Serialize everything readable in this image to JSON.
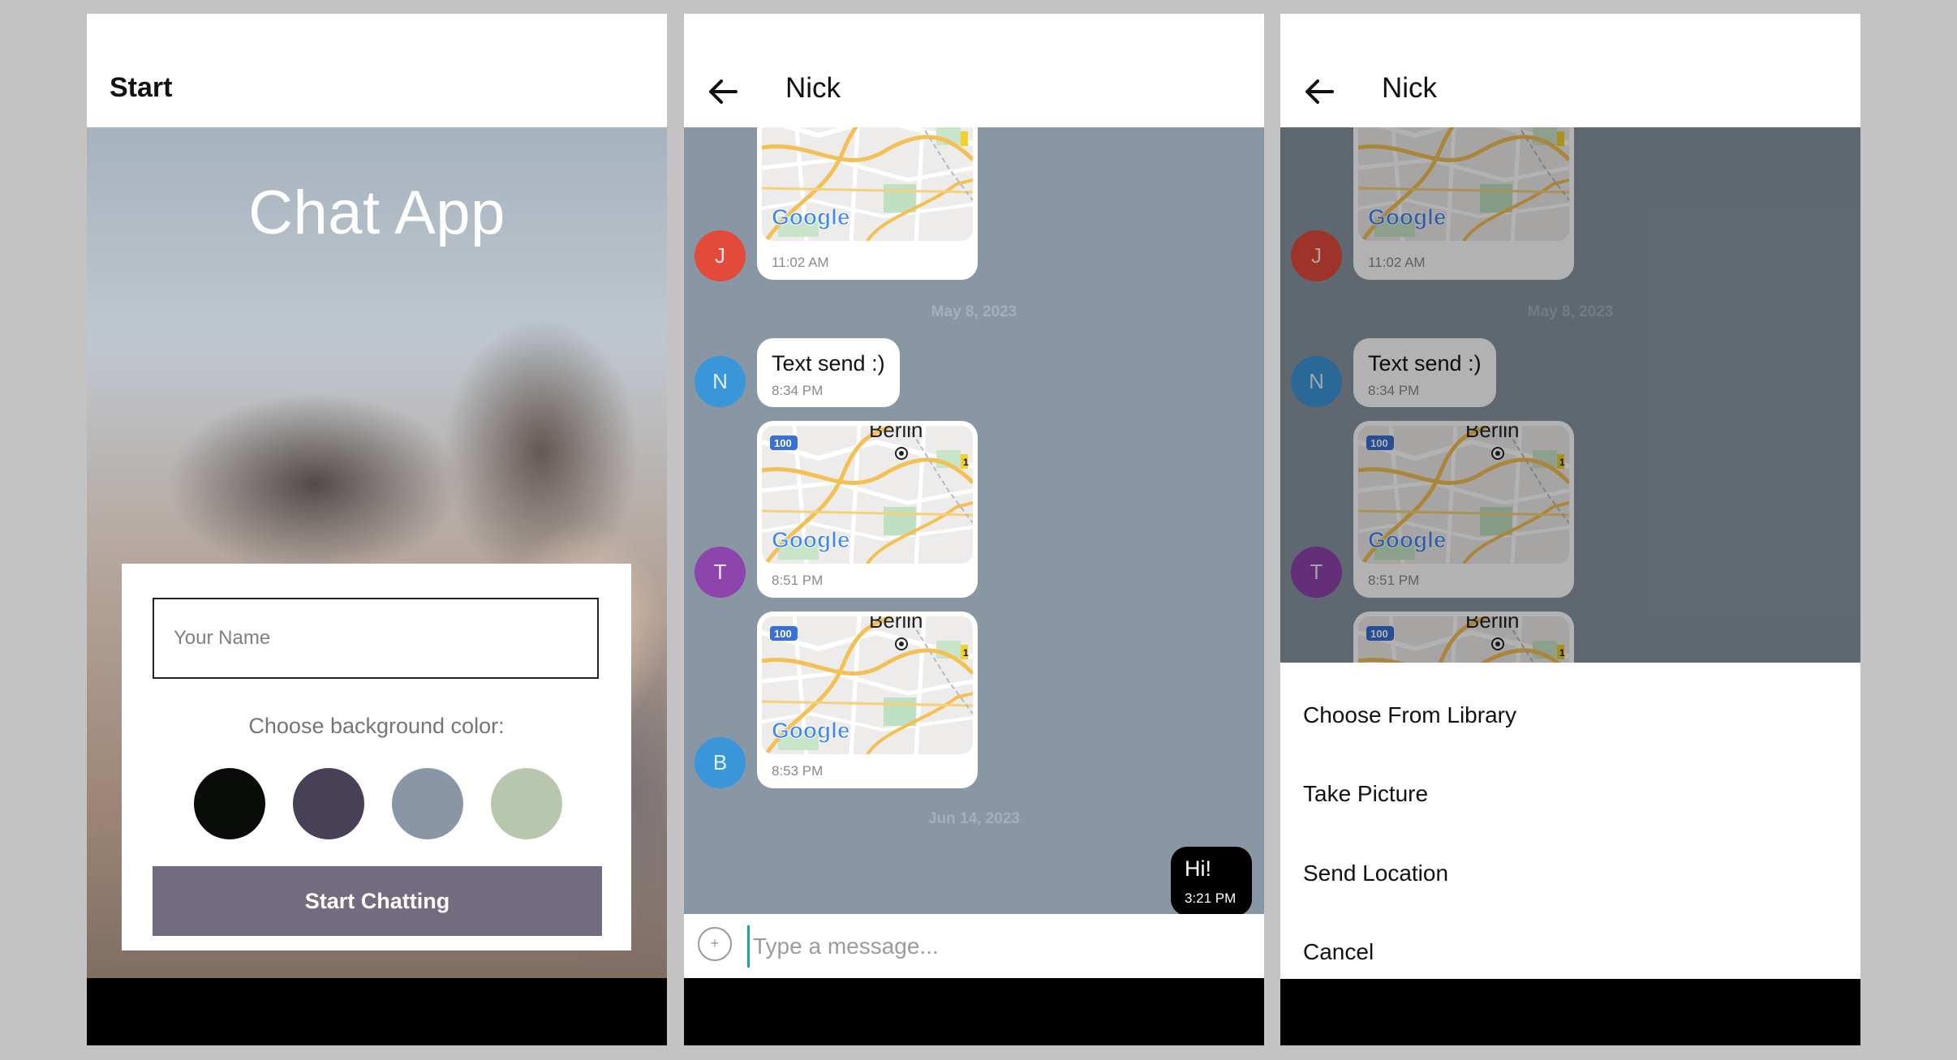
{
  "screens": {
    "start": {
      "header_title": "Start",
      "app_title": "Chat App",
      "name_placeholder": "Your Name",
      "choose_label": "Choose background color:",
      "swatches": [
        "#090c08",
        "#474056",
        "#8a95a5",
        "#b9c6ae"
      ],
      "start_button": "Start Chatting"
    },
    "chat": {
      "header_title": "Nick",
      "date_1": "May 8, 2023",
      "date_2": "Jun 14, 2023",
      "messages": [
        {
          "avatar": "J",
          "avatar_color": "#e24a3b",
          "time": "11:02 AM",
          "type": "map"
        },
        {
          "avatar": "N",
          "avatar_color": "#3b96d9",
          "text": "Text send :)",
          "time": "8:34 PM",
          "type": "text"
        },
        {
          "avatar": "T",
          "avatar_color": "#8e44ad",
          "time": "8:51 PM",
          "type": "map",
          "map_label": "Berlin"
        },
        {
          "avatar": "B",
          "avatar_color": "#3b96d9",
          "time": "8:53 PM",
          "type": "map",
          "map_label": "Berlin"
        }
      ],
      "own_message": {
        "text": "Hi!",
        "time": "3:21 PM"
      },
      "input_placeholder": "Type a message...",
      "map_brand": "Google",
      "map_shield": "100",
      "map_shield_2": "1"
    },
    "action_sheet": {
      "options": [
        "Choose From Library",
        "Take Picture",
        "Send Location",
        "Cancel"
      ]
    }
  },
  "colors": {
    "chat_background": "#8996a3",
    "start_button": "#736b7f",
    "input_cursor": "#1ba39c"
  }
}
